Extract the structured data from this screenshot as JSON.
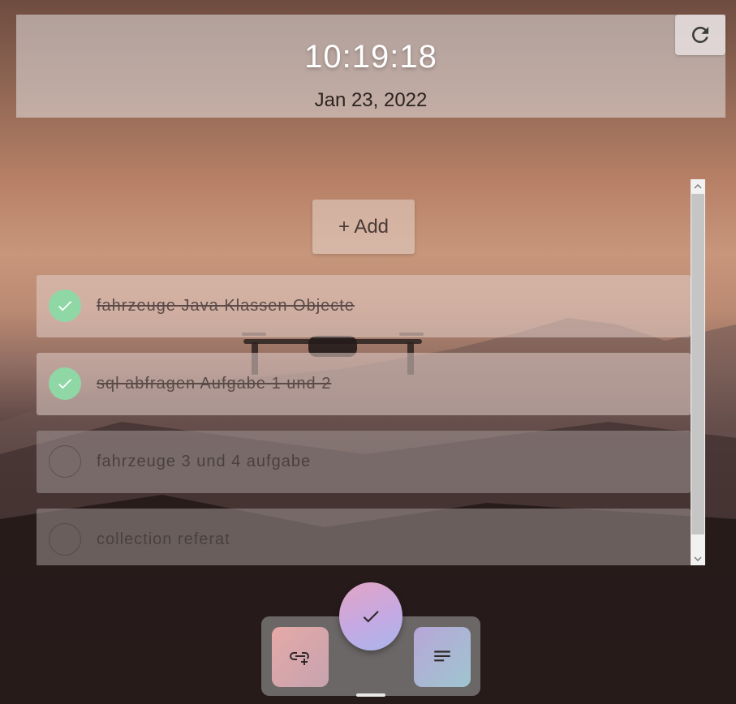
{
  "header": {
    "time": "10:19:18",
    "date": "Jan 23, 2022"
  },
  "toolbar": {
    "refresh_icon": "refresh-icon"
  },
  "list": {
    "add_label": "+ Add",
    "items": [
      {
        "label": "fahrzeuge Java Klassen Objecte",
        "done": true
      },
      {
        "label": "sql abfragen Aufgabe 1 und 2",
        "done": true
      },
      {
        "label": "fahrzeuge 3 und 4 aufgabe",
        "done": false
      },
      {
        "label": "collection referat",
        "done": false
      }
    ]
  },
  "nav": {
    "left_icon": "link-add-icon",
    "center_icon": "checkmark-icon",
    "right_icon": "notes-icon"
  },
  "colors": {
    "done_check": "#8fd8a6",
    "clock_text": "#ffffff"
  }
}
